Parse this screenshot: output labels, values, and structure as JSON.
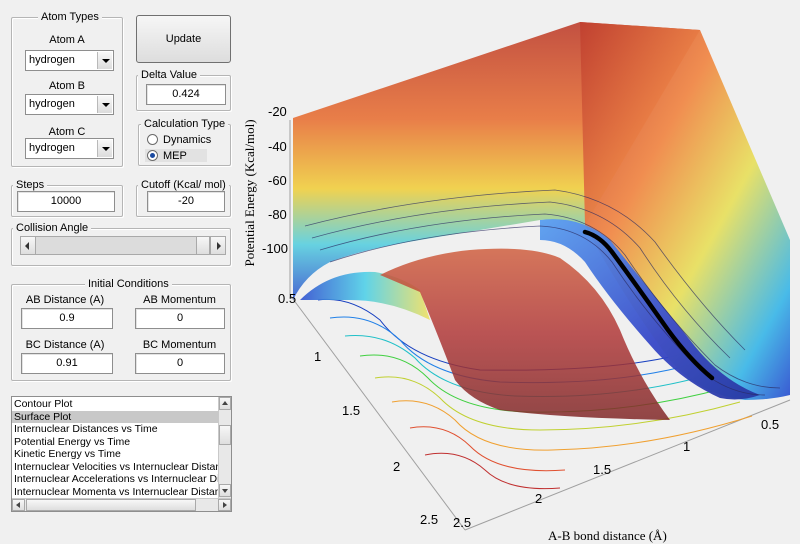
{
  "atom_types": {
    "legend": "Atom Types",
    "atom_a": {
      "label": "Atom A",
      "value": "hydrogen"
    },
    "atom_b": {
      "label": "Atom B",
      "value": "hydrogen"
    },
    "atom_c": {
      "label": "Atom C",
      "value": "hydrogen"
    }
  },
  "update_label": "Update",
  "delta": {
    "legend": "Delta Value",
    "value": "0.424"
  },
  "calc_type": {
    "legend": "Calculation Type",
    "options": [
      "Dynamics",
      "MEP"
    ],
    "selected": "MEP"
  },
  "steps": {
    "legend": "Steps",
    "value": "10000"
  },
  "cutoff": {
    "legend": "Cutoff (Kcal/ mol)",
    "value": "-20"
  },
  "collision": {
    "legend": "Collision Angle",
    "fraction": 1.0
  },
  "initial": {
    "legend": "Initial Conditions",
    "ab_distance": {
      "label": "AB Distance (A)",
      "value": "0.9"
    },
    "ab_momentum": {
      "label": "AB Momentum",
      "value": "0"
    },
    "bc_distance": {
      "label": "BC Distance (A)",
      "value": "0.91"
    },
    "bc_momentum": {
      "label": "BC Momentum",
      "value": "0"
    }
  },
  "plot_list": {
    "items": [
      "Contour Plot",
      "Surface Plot",
      "Internuclear Distances vs Time",
      "Potential Energy vs Time",
      "Kinetic Energy vs Time",
      "Internuclear Velocities vs Internuclear Distance",
      "Internuclear Accelerations vs Internuclear Distance",
      "Internuclear Momenta vs Internuclear Distance"
    ],
    "selected": 1
  },
  "plot": {
    "z_axis_label": "Potential Energy (Kcal/mol)",
    "x_axis_label": "A-B bond distance (Å)",
    "z_ticks": [
      "-20",
      "-40",
      "-60",
      "-80",
      "-100"
    ],
    "left_axis_ticks": [
      "0.5",
      "1",
      "1.5",
      "2",
      "2.5"
    ],
    "bottom_axis_ticks": [
      "2.5",
      "2",
      "1.5",
      "1",
      "0.5"
    ]
  },
  "colors": {
    "surface_hot": "#c84030",
    "surface_mid": "#f0d040",
    "surface_cool": "#3050d0",
    "path": "#000000"
  }
}
